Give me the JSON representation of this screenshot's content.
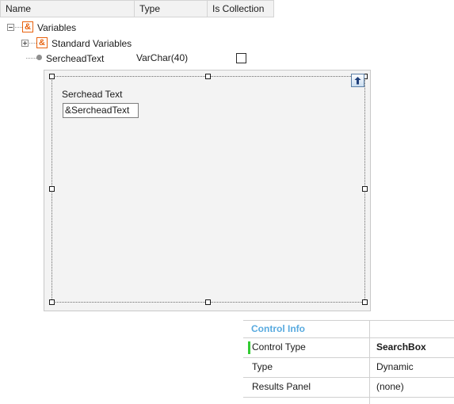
{
  "variables_grid": {
    "columns": [
      {
        "label": "Name"
      },
      {
        "label": "Type"
      },
      {
        "label": "Is Collection"
      }
    ],
    "rows": [
      {
        "name": "Variables",
        "icon": "ampersand-icon",
        "icon_glyph": "&",
        "expander": "minus",
        "type": "",
        "is_collection": null
      },
      {
        "name": "Standard Variables",
        "icon": "ampersand-icon",
        "icon_glyph": "&",
        "expander": "plus",
        "type": "",
        "is_collection": null
      },
      {
        "name": "SercheadText",
        "icon": "bullet-icon",
        "icon_glyph": "",
        "expander": "none",
        "type": "VarChar(40)",
        "is_collection": false
      }
    ]
  },
  "designer": {
    "field_label": "Serchead Text",
    "field_value": "&SercheadText",
    "scroll_up_icon": "arrow-up-icon"
  },
  "control_info": {
    "title": "Control Info",
    "rows": [
      {
        "label": "Control Type",
        "value": "SearchBox",
        "selected": true
      },
      {
        "label": "Type",
        "value": "Dynamic",
        "selected": false
      },
      {
        "label": "Results Panel",
        "value": "(none)",
        "selected": false
      }
    ]
  },
  "colors": {
    "accent_blue": "#58aadf",
    "marker_green": "#33cc33",
    "icon_orange": "#e8620e",
    "header_bg": "#f2f2f2",
    "designer_bg": "#f3f3f3",
    "border": "#d0d0d0"
  }
}
